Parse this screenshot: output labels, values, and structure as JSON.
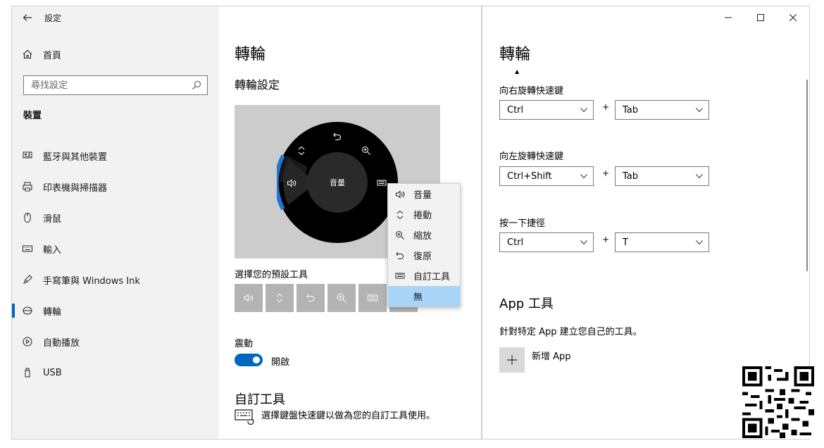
{
  "left_window": {
    "title": "設定",
    "home_label": "首頁",
    "search_placeholder": "尋找設定",
    "section_head": "裝置",
    "sidebar_items": [
      {
        "label": "藍牙與其他裝置",
        "icon": "bluetooth-devices-icon"
      },
      {
        "label": "印表機與掃描器",
        "icon": "printer-icon"
      },
      {
        "label": "滑鼠",
        "icon": "mouse-icon"
      },
      {
        "label": "輸入",
        "icon": "keyboard-icon"
      },
      {
        "label": "手寫筆與 Windows Ink",
        "icon": "pen-icon"
      },
      {
        "label": "轉輪",
        "icon": "dial-icon",
        "active": true
      },
      {
        "label": "自動播放",
        "icon": "autoplay-icon"
      },
      {
        "label": "USB",
        "icon": "usb-icon"
      }
    ],
    "page_title": "轉輪",
    "sub_title": "轉輪設定",
    "dial_center_label": "音量",
    "context_menu": [
      {
        "label": "音量",
        "icon": "volume-icon"
      },
      {
        "label": "捲動",
        "icon": "scroll-icon"
      },
      {
        "label": "縮放",
        "icon": "zoom-icon"
      },
      {
        "label": "復原",
        "icon": "undo-icon"
      },
      {
        "label": "自訂工具",
        "icon": "custom-tool-icon"
      },
      {
        "label": "無",
        "icon": "",
        "selected": true
      }
    ],
    "tools_label": "選擇您的預設工具",
    "vibration_label": "震動",
    "vibration_state": "開啟",
    "custom_title": "自訂工具",
    "custom_desc": "選擇鍵盤快速鍵以做為您的自訂工具使用。",
    "accent_color": "#0067c0"
  },
  "right_window": {
    "page_title": "轉輪",
    "shortcuts": [
      {
        "label": "向右旋轉快速鍵",
        "modifier": "Ctrl",
        "key": "Tab"
      },
      {
        "label": "向左旋轉快速鍵",
        "modifier": "Ctrl+Shift",
        "key": "Tab"
      },
      {
        "label": "按一下捷徑",
        "modifier": "Ctrl",
        "key": "T"
      }
    ],
    "plus_sign": "+",
    "app_tools_title": "App 工具",
    "app_tools_desc": "針對特定 App 建立您自己的工具。",
    "add_app_label": "新增 App"
  }
}
